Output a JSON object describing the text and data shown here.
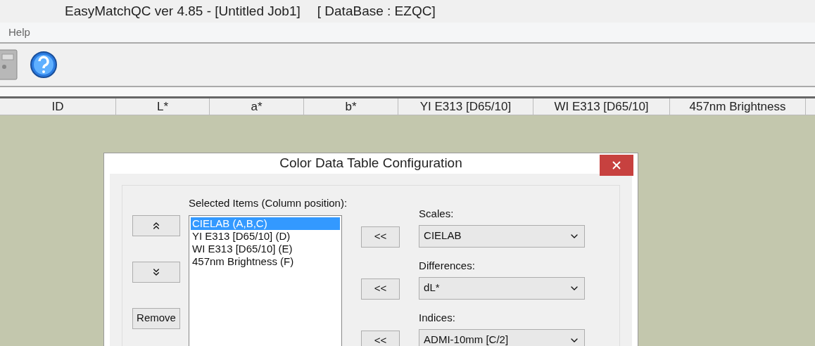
{
  "window": {
    "title": "EasyMatchQC ver 4.85 - [Untitled Job1]",
    "database": "[ DataBase : EZQC]"
  },
  "menu": [
    "Help"
  ],
  "table": {
    "columns": [
      "ID",
      "L*",
      "a*",
      "b*",
      "YI E313 [D65/10]",
      "WI E313 [D65/10]",
      "457nm Brightness"
    ]
  },
  "dialog": {
    "title": "Color Data Table Configuration",
    "selected_items_label": "Selected Items (Column position):",
    "selected_items": [
      {
        "label": "CIELAB (A,B,C)",
        "selected": true
      },
      {
        "label": "YI E313 [D65/10] (D)",
        "selected": false
      },
      {
        "label": "WI E313 [D65/10] (E)",
        "selected": false
      },
      {
        "label": "457nm Brightness (F)",
        "selected": false
      }
    ],
    "remove_button": "Remove",
    "pickers": [
      {
        "label": "Scales:",
        "add_button": "<<",
        "value": "CIELAB"
      },
      {
        "label": "Differences:",
        "add_button": "<<",
        "value": "dL*"
      },
      {
        "label": "Indices:",
        "add_button": "<<",
        "value": "ADMI-10mm [C/2]"
      }
    ]
  }
}
